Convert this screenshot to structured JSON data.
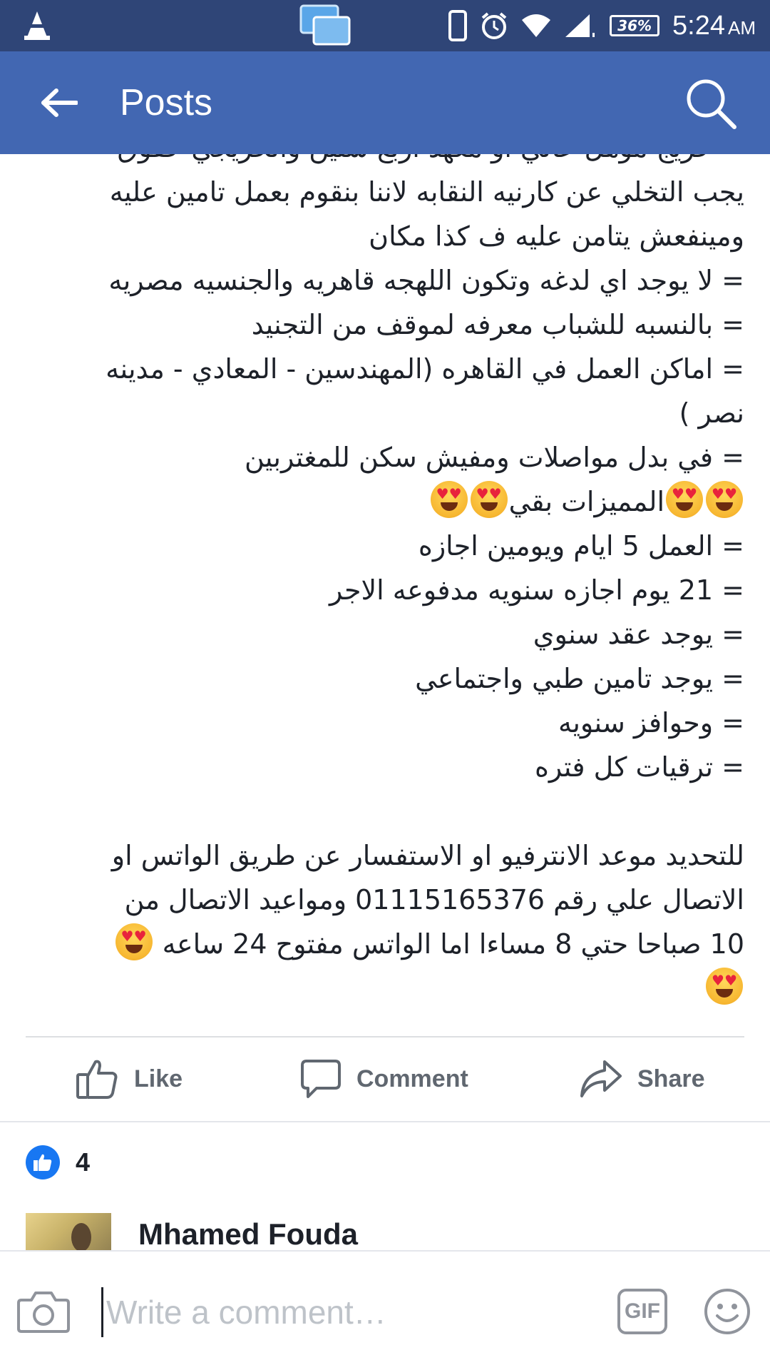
{
  "status_bar": {
    "battery": "36%",
    "time": "5:24",
    "ampm": "AM"
  },
  "app_bar": {
    "title": "Posts"
  },
  "post": {
    "lines": [
      "= خريج موهل عالي او معهد اربع سنين  والخريجي حقوق",
      "يجب التخلي عن كارنيه النقابه لاننا بنقوم بعمل تامين عليه",
      "ومينفعش يتامن عليه ف كذا مكان",
      "= لا يوجد اي لدغه وتكون اللهجه قاهريه والجنسيه مصريه",
      "= بالنسبه للشباب معرفه لموقف من التجنيد",
      "= اماكن العمل في القاهره (المهندسين  -  المعادي  -  مدينه",
      "نصر )",
      "= في بدل مواصلات ومفيش سكن للمغتربين",
      "المميزات بقي",
      "= العمل 5 ايام ويومين اجازه",
      "= 21 يوم اجازه سنويه مدفوعه الاجر",
      "= يوجد عقد سنوي",
      "= يوجد تامين طبي واجتماعي",
      "= وحوافز سنويه",
      "= ترقيات كل فتره",
      "للتحديد موعد الانترفيو او الاستفسار عن طريق الواتس او",
      "الاتصال علي رقم 01115165376  ومواعيد الاتصال من",
      "10 صباحا حتي 8 مساءا اما الواتس مفتوح 24 ساعه"
    ]
  },
  "actions": {
    "like": "Like",
    "comment": "Comment",
    "share": "Share"
  },
  "reactions": {
    "count": "4"
  },
  "comment_preview": {
    "author": "Mhamed Fouda"
  },
  "composer": {
    "placeholder": "Write a comment…",
    "gif_label": "GIF"
  },
  "colors": {
    "status_bar": "#2f4577",
    "app_bar": "#4267b2",
    "like_blue": "#1877f2"
  }
}
